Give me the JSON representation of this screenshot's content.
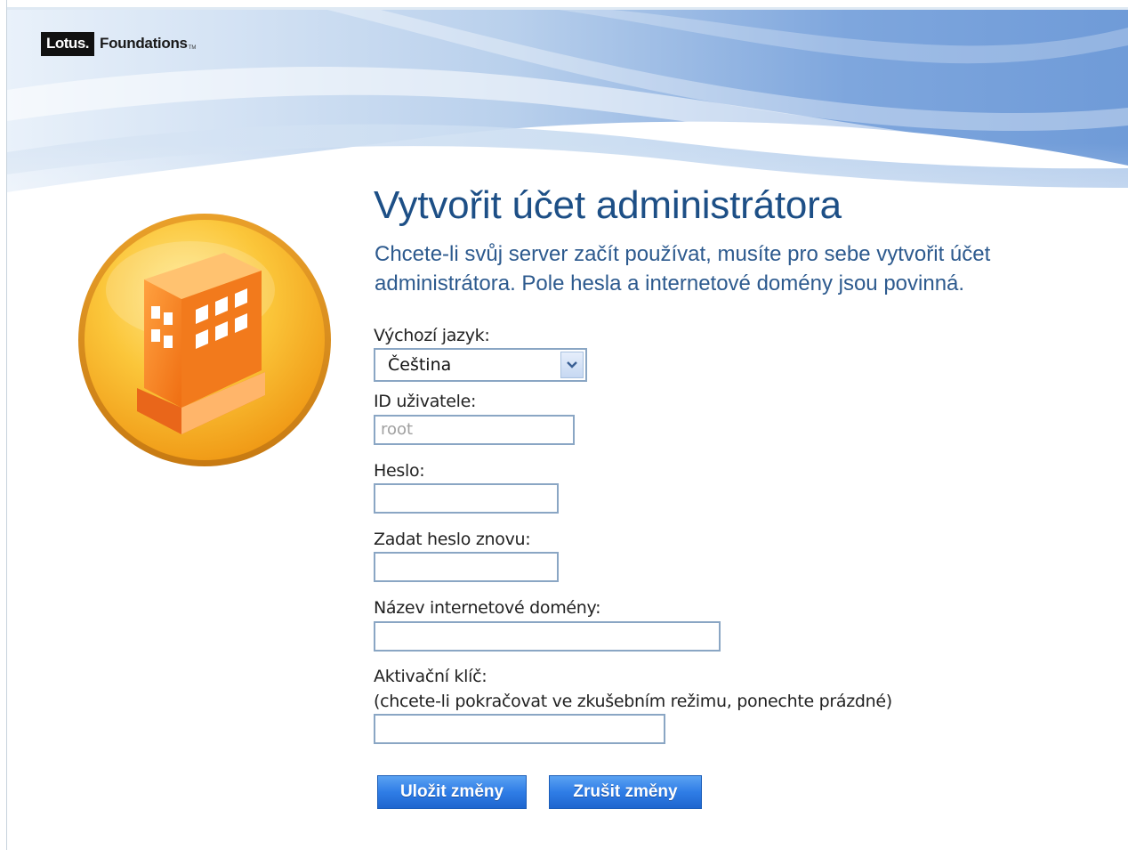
{
  "branding": {
    "logo_lotus": "Lotus.",
    "logo_foundations": "Foundations",
    "logo_tm": "TM"
  },
  "page": {
    "title": "Vytvořit účet administrátora",
    "subtitle": "Chcete-li svůj server začít používat, musíte pro sebe vytvořit účet administrátora. Pole hesla a internetové domény jsou povinná."
  },
  "form": {
    "language": {
      "label": "Výchozí jazyk:",
      "selected": "Čeština"
    },
    "user_id": {
      "label": "ID uživatele:",
      "value": "root"
    },
    "password": {
      "label": "Heslo:",
      "value": ""
    },
    "password_confirm": {
      "label": "Zadat heslo znovu:",
      "value": ""
    },
    "domain": {
      "label": "Název internetové domény:",
      "value": ""
    },
    "activation_key": {
      "label": "Aktivační klíč:",
      "hint": "(chcete-li pokračovat ve zkušebním režimu, ponechte prázdné)",
      "value": ""
    }
  },
  "actions": {
    "save_label": "Uložit změny",
    "cancel_label": "Zrušit změny"
  },
  "colors": {
    "title": "#1d4f86",
    "button": "#2f7de6",
    "emblem_outer": "#f7b52b",
    "building": "#f07b1e"
  },
  "icons": {
    "emblem": "building-icon",
    "dropdown": "chevron-down-icon"
  }
}
